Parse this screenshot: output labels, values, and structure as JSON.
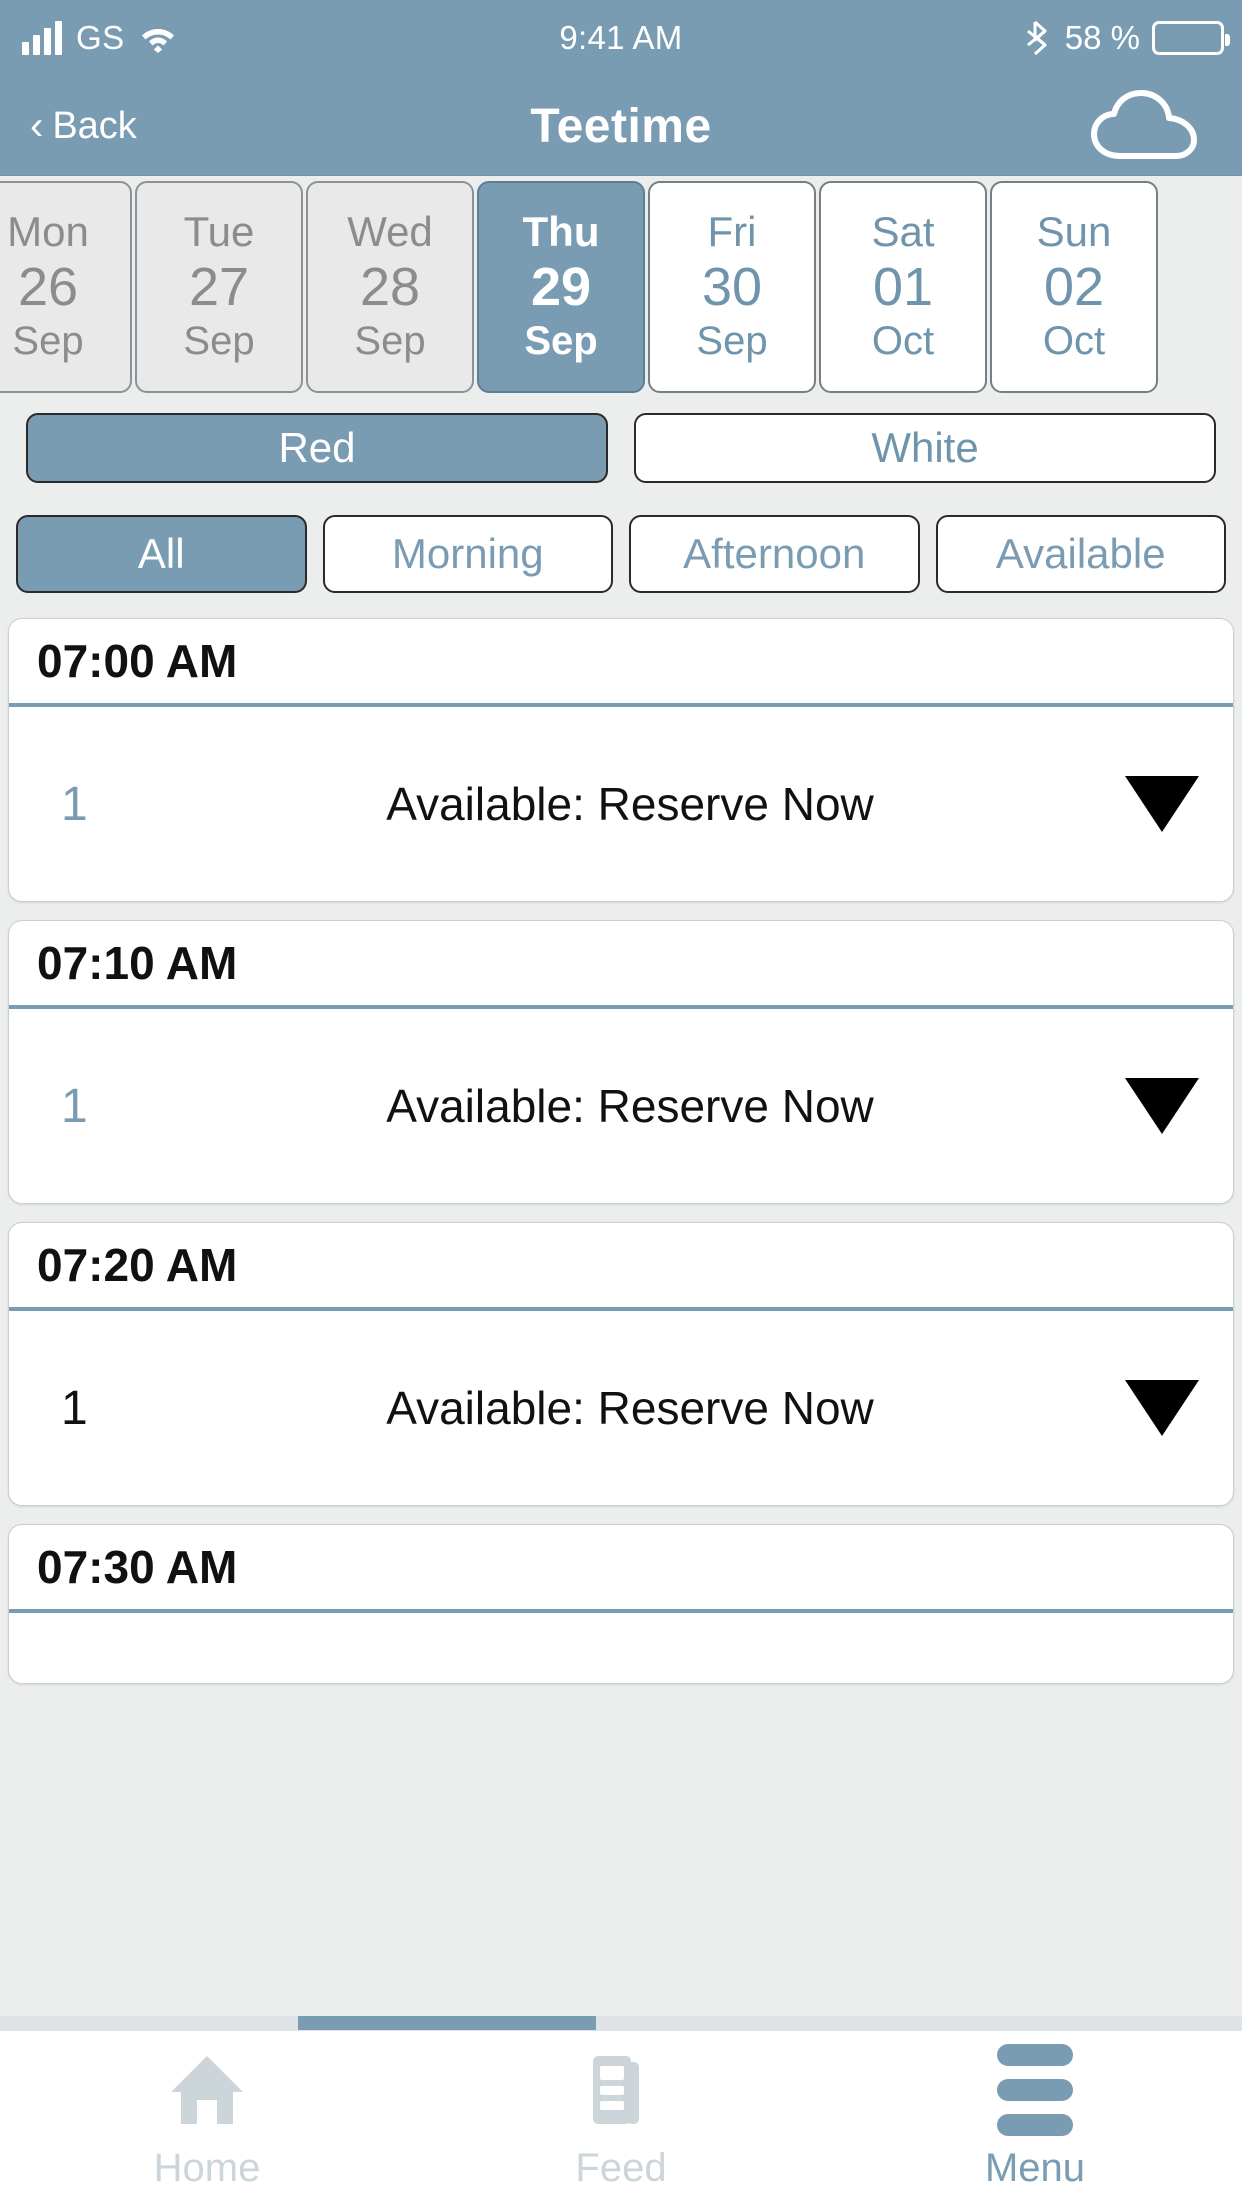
{
  "statusbar": {
    "carrier": "GS",
    "time": "9:41 AM",
    "battery_percent": "58 %",
    "signal_icon": "cellular-signal-icon",
    "wifi_icon": "wifi-icon",
    "bluetooth_icon": "bluetooth-icon",
    "battery_icon": "battery-icon"
  },
  "header": {
    "back_label": "Back",
    "back_chevron": "‹",
    "title": "Teetime",
    "cloud_icon": "cloud-icon"
  },
  "date_strip": {
    "days": [
      {
        "dow": "Mon",
        "day": "26",
        "month": "Sep",
        "state": "disabled"
      },
      {
        "dow": "Tue",
        "day": "27",
        "month": "Sep",
        "state": "disabled"
      },
      {
        "dow": "Wed",
        "day": "28",
        "month": "Sep",
        "state": "disabled"
      },
      {
        "dow": "Thu",
        "day": "29",
        "month": "Sep",
        "state": "selected"
      },
      {
        "dow": "Fri",
        "day": "30",
        "month": "Sep",
        "state": "enabled"
      },
      {
        "dow": "Sat",
        "day": "01",
        "month": "Oct",
        "state": "enabled"
      },
      {
        "dow": "Sun",
        "day": "02",
        "month": "Oct",
        "state": "enabled"
      }
    ]
  },
  "course_segment": {
    "options": [
      {
        "label": "Red",
        "state": "active"
      },
      {
        "label": "White",
        "state": "inactive"
      }
    ]
  },
  "filters": {
    "tabs": [
      {
        "label": "All",
        "state": "active"
      },
      {
        "label": "Morning",
        "state": "inactive"
      },
      {
        "label": "Afternoon",
        "state": "inactive"
      },
      {
        "label": "Available",
        "state": "inactive"
      }
    ]
  },
  "teetimes": [
    {
      "time": "07:00 AM",
      "count": "1",
      "count_style": "accent",
      "status": "Available: Reserve Now",
      "caret_icon": "chevron-down-icon"
    },
    {
      "time": "07:10 AM",
      "count": "1",
      "count_style": "accent",
      "status": "Available: Reserve Now",
      "caret_icon": "chevron-down-icon"
    },
    {
      "time": "07:20 AM",
      "count": "1",
      "count_style": "plain",
      "status": "Available: Reserve Now",
      "caret_icon": "chevron-down-icon"
    },
    {
      "time": "07:30 AM",
      "count": "",
      "count_style": "plain",
      "status": "",
      "caret_icon": ""
    }
  ],
  "tabbar": {
    "items": [
      {
        "label": "Home",
        "icon": "home-icon",
        "state": "inactive"
      },
      {
        "label": "Feed",
        "icon": "document-icon",
        "state": "inactive"
      },
      {
        "label": "Menu",
        "icon": "hamburger-menu-icon",
        "state": "active"
      }
    ]
  },
  "colors": {
    "brand_blue": "#7a9cb3",
    "page_background": "#eceded",
    "card_background": "#ffffff",
    "disabled_text": "#8c8c8c",
    "inactive_tab": "#ccd5da"
  }
}
